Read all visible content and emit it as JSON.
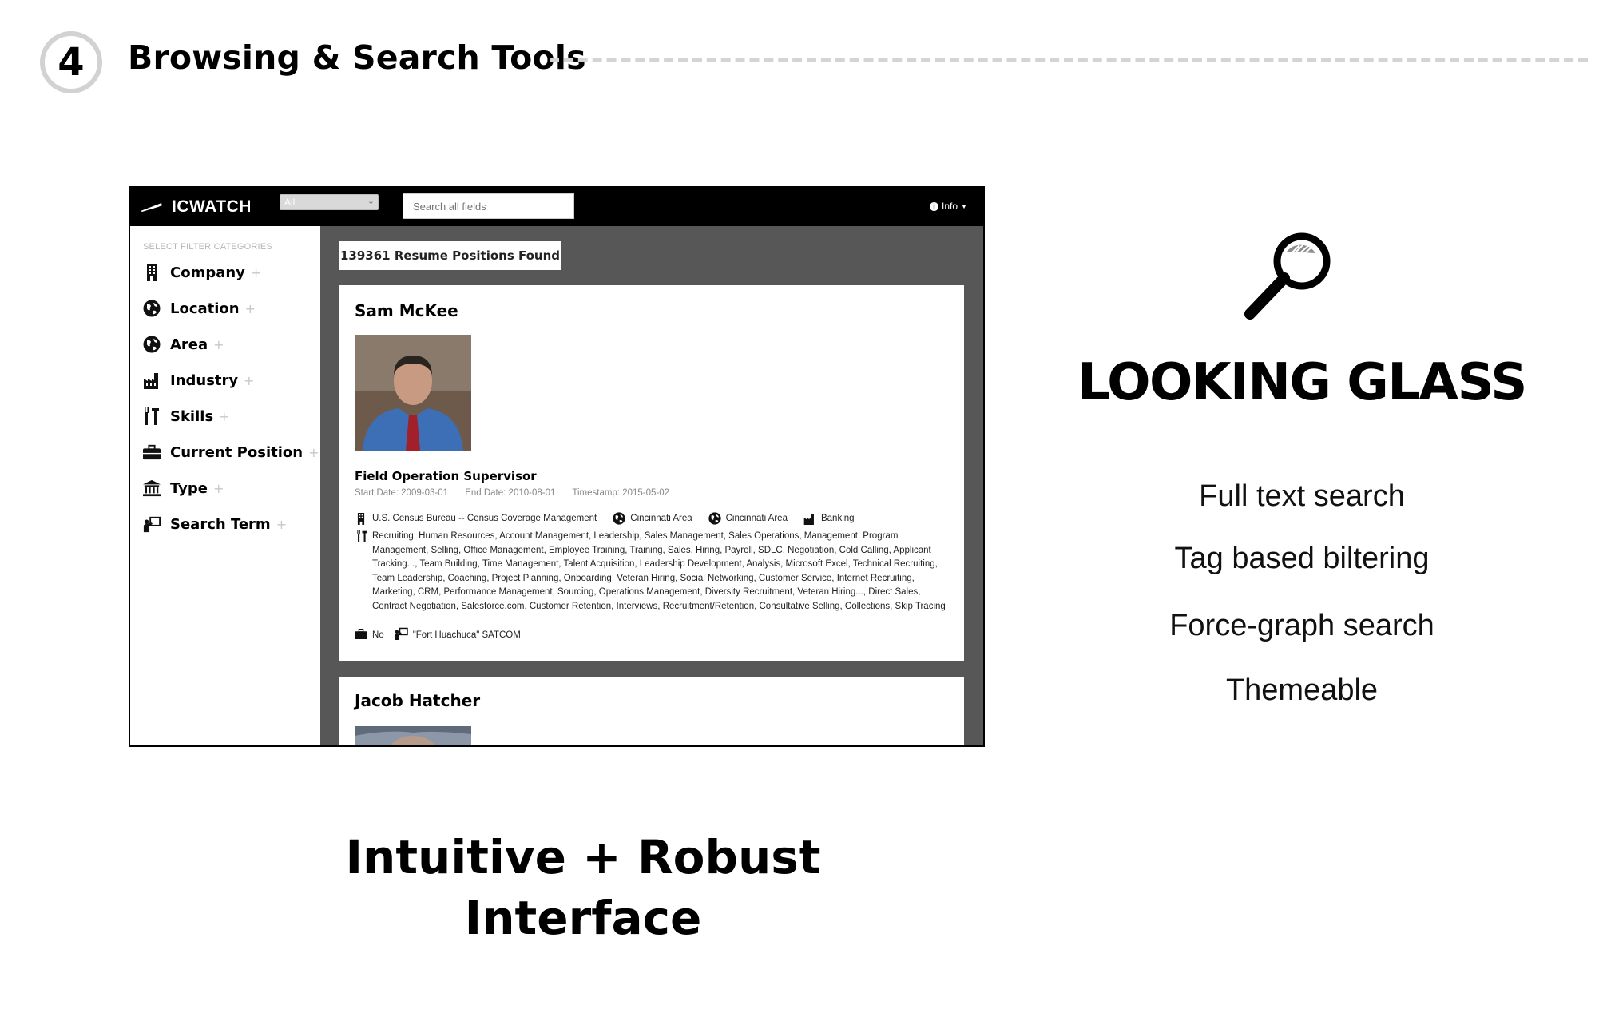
{
  "slide": {
    "step_number": "4",
    "title": "Browsing & Search Tools",
    "tagline_line1": "Intuitive + Robust",
    "tagline_line2": "Interface"
  },
  "app": {
    "brand": "ICWATCH",
    "category_select": {
      "selected": "All"
    },
    "search": {
      "placeholder": "Search all fields",
      "value": ""
    },
    "info_menu": "Info",
    "sidebar": {
      "heading": "SELECT FILTER CATEGORIES",
      "items": [
        {
          "label": "Company",
          "icon": "building-icon"
        },
        {
          "label": "Location",
          "icon": "globe-icon"
        },
        {
          "label": "Area",
          "icon": "globe-icon"
        },
        {
          "label": "Industry",
          "icon": "factory-icon"
        },
        {
          "label": "Skills",
          "icon": "tools-icon"
        },
        {
          "label": "Current Position",
          "icon": "briefcase-icon"
        },
        {
          "label": "Type",
          "icon": "bank-icon"
        },
        {
          "label": "Search Term",
          "icon": "presenter-icon"
        }
      ]
    },
    "results_count": "139361 Resume Positions Found",
    "results": [
      {
        "name": "Sam McKee",
        "position": "Field Operation Supervisor",
        "start_date": "Start Date: 2009-03-01",
        "end_date": "End Date: 2010-08-01",
        "timestamp": "Timestamp: 2015-05-02",
        "company": "U.S. Census Bureau -- Census Coverage Management",
        "location": "Cincinnati Area",
        "area": "Cincinnati Area",
        "industry": "Banking",
        "skills": "Recruiting,  Human Resources,  Account Management,  Leadership,  Sales Management,  Sales Operations,  Management,  Program Management,  Selling,  Office Management,  Employee Training,  Training,  Sales,  Hiring,  Payroll,  SDLC,  Negotiation,  Cold Calling,  Applicant Tracking...,  Team Building,  Time Management,  Talent Acquisition,  Leadership Development,  Analysis,  Microsoft Excel,  Technical Recruiting,  Team Leadership,  Coaching,  Project Planning,  Onboarding,  Veteran Hiring,  Social Networking,  Customer Service,  Internet Recruiting,  Marketing,  CRM,  Performance Management,  Sourcing,  Operations Management,  Diversity Recruitment,  Veteran Hiring...,  Direct Sales,  Contract Negotiation,  Salesforce.com,  Customer Retention,  Interviews,  Recruitment/Retention,  Consultative Selling,  Collections,  Skip Tracing",
        "current_position": "No",
        "search_term": "\"Fort Huachuca\" SATCOM"
      },
      {
        "name": "Jacob Hatcher"
      }
    ]
  },
  "product": {
    "name": "LOOKING GLASS",
    "features": [
      "Full text search",
      "Tag based biltering",
      "Force-graph search",
      "Themeable"
    ]
  }
}
